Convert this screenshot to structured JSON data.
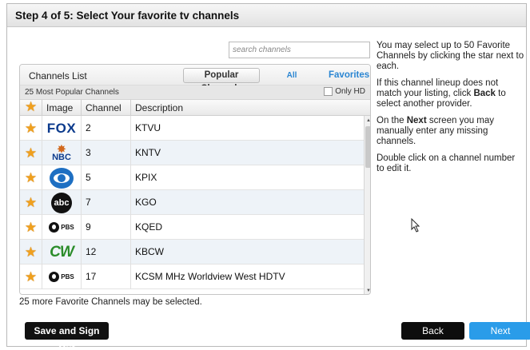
{
  "dialog": {
    "title": "Step 4 of 5: Select Your favorite tv channels"
  },
  "search": {
    "placeholder": "search channels"
  },
  "channels_panel": {
    "title": "Channels List",
    "tabs": {
      "popular": "Popular Channels",
      "all": "All Channels",
      "favorites": "Favorites"
    },
    "subtitle": "25 Most Popular Channels",
    "only_hd_label": "Only HD",
    "only_hd_checked": false,
    "columns": {
      "star": "",
      "image": "Image",
      "channel": "Channel",
      "description": "Description"
    },
    "rows": [
      {
        "logo": "FOX",
        "logo_icon": "fox-logo-icon",
        "channel": "2",
        "description": "KTVU"
      },
      {
        "logo": "NBC",
        "logo_icon": "nbc-logo-icon",
        "channel": "3",
        "description": "KNTV"
      },
      {
        "logo": "CBS",
        "logo_icon": "cbs-logo-icon",
        "channel": "5",
        "description": "KPIX"
      },
      {
        "logo": "abc",
        "logo_icon": "abc-logo-icon",
        "channel": "7",
        "description": "KGO"
      },
      {
        "logo": "PBS",
        "logo_icon": "pbs-logo-icon",
        "channel": "9",
        "description": "KQED"
      },
      {
        "logo": "CW",
        "logo_icon": "cw-logo-icon",
        "channel": "12",
        "description": "KBCW"
      },
      {
        "logo": "PBS",
        "logo_icon": "pbs-logo-icon",
        "channel": "17",
        "description": "KCSM MHz Worldview West HDTV"
      }
    ]
  },
  "remaining_text": "25 more Favorite Channels may be selected.",
  "help": {
    "p1": "You may select up to 50 Favorite Channels by clicking the star next to each.",
    "p2_prefix": "If this channel lineup does not match your listing, click ",
    "p2_bold": "Back",
    "p2_suffix": " to select another provider.",
    "p3_prefix": "On the ",
    "p3_bold": "Next",
    "p3_suffix": " screen you may manually enter any missing channels.",
    "p4": "Double click on a channel number to edit it."
  },
  "buttons": {
    "save_sign_out": "Save and Sign Out",
    "back": "Back",
    "next": "Next"
  },
  "colors": {
    "accent_blue": "#2a9ce9",
    "star_orange": "#f0a01e",
    "link_blue": "#2b86d2"
  }
}
